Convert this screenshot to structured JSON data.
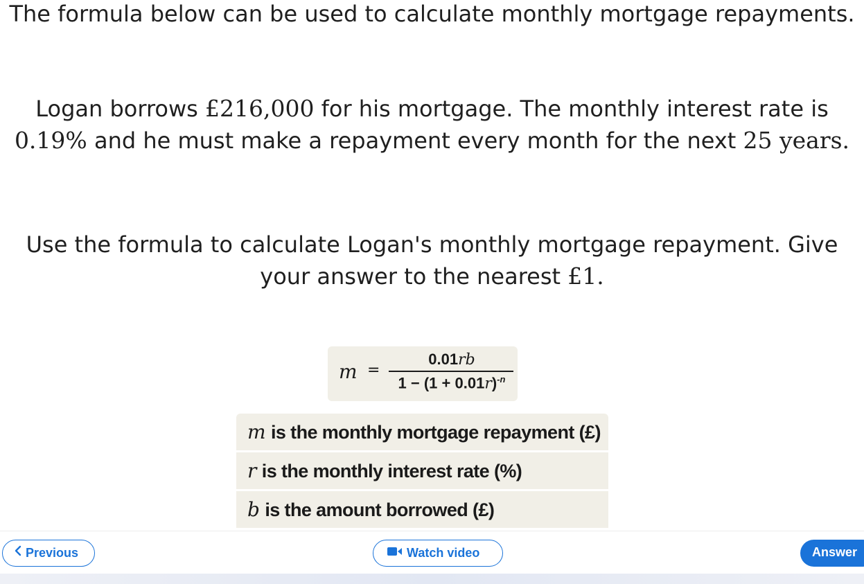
{
  "question": {
    "intro": "The formula below can be used to calculate monthly mortgage repayments.",
    "scenario": {
      "t1": "Logan borrows ",
      "amount": "£216,000",
      "t2": " for his mortgage. The monthly interest rate is ",
      "rate": "0.19%",
      "t3": " and he must make a repayment every month for the next ",
      "term": "25 years."
    },
    "task": {
      "t1": "Use the formula to calculate Logan's monthly mortgage repayment. Give your answer to the nearest ",
      "unit": "£1."
    }
  },
  "formula": {
    "lhs": "m",
    "eq": "=",
    "num_const": "0.01",
    "num_vars": "rb",
    "den_a": "1 − (1 + 0.01",
    "den_var": "r",
    "den_b": ")",
    "den_exp": "-n"
  },
  "definitions": [
    {
      "var": "m",
      "text": "is the monthly mortgage repayment (£)"
    },
    {
      "var": "r",
      "text": "is the monthly interest rate (%)"
    },
    {
      "var": "b",
      "text": "is the amount borrowed (£)"
    }
  ],
  "nav": {
    "previous_label": "Previous",
    "video_label": "Watch video",
    "answer_label": "Answer"
  },
  "colors": {
    "accent": "#1a73d9",
    "panel": "#f1efe7",
    "text": "#1f1f1f"
  }
}
